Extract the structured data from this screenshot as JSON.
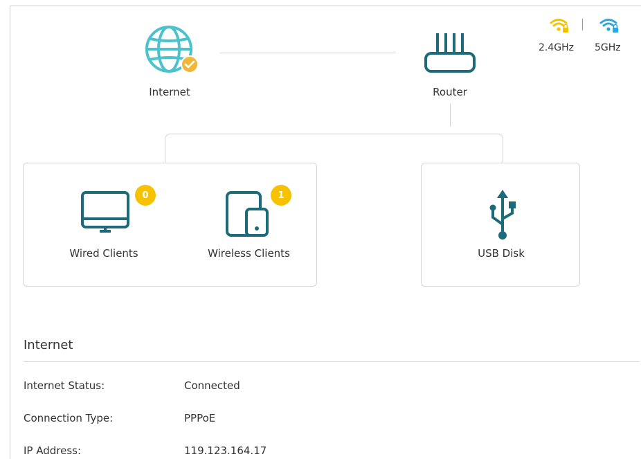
{
  "topology": {
    "internet": {
      "label": "Internet",
      "icon": "globe-icon",
      "status_icon": "check-circle-icon"
    },
    "router": {
      "label": "Router",
      "icon": "router-icon"
    },
    "bands": [
      {
        "label": "2.4GHz",
        "icon": "wifi-lock-icon",
        "color": "#f6c200"
      },
      {
        "label": "5GHz",
        "icon": "wifi-lock-icon",
        "color": "#2aa7e0"
      }
    ],
    "clients": {
      "wired": {
        "label": "Wired Clients",
        "count": "0",
        "icon": "monitor-icon"
      },
      "wireless": {
        "label": "Wireless Clients",
        "count": "1",
        "icon": "tablet-phone-icon"
      }
    },
    "usb": {
      "label": "USB Disk",
      "icon": "usb-icon"
    }
  },
  "internet_section": {
    "title": "Internet",
    "rows": [
      {
        "key": "Internet Status:",
        "value": "Connected"
      },
      {
        "key": "Connection Type:",
        "value": "PPPoE"
      },
      {
        "key": "IP Address:",
        "value": "119.123.164.17"
      }
    ]
  },
  "colors": {
    "icon_teal": "#1d6b7a",
    "globe_cyan": "#4cc3cc",
    "badge_yellow": "#f6c200"
  }
}
